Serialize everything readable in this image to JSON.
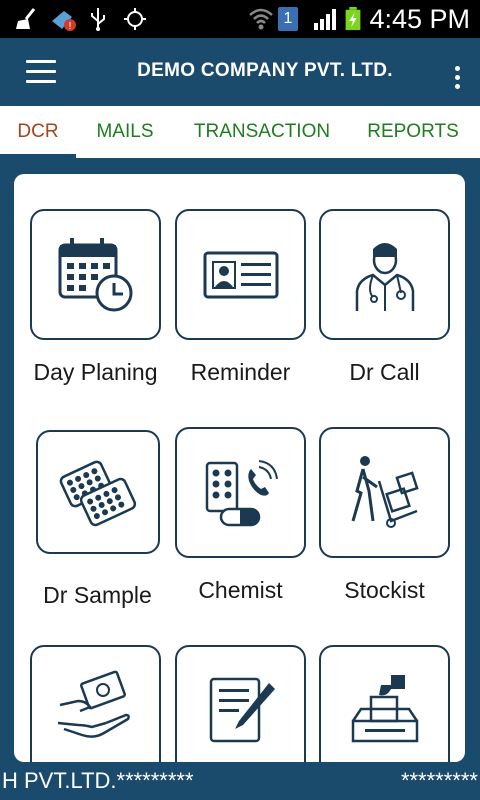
{
  "status_bar": {
    "time": "4:45 PM",
    "sim_label": "1",
    "icons": [
      "broom-icon",
      "notification-alert-icon",
      "usb-icon",
      "gps-icon",
      "wifi-icon",
      "sim-icon",
      "signal-icon",
      "battery-charging-icon"
    ]
  },
  "app_bar": {
    "title": "DEMO COMPANY PVT. LTD.",
    "menu_icon": "hamburger-menu-icon",
    "overflow_icon": "more-vert-icon"
  },
  "tabs": [
    {
      "label": "DCR",
      "active": true
    },
    {
      "label": "MAILS",
      "active": false
    },
    {
      "label": "TRANSACTION",
      "active": false
    },
    {
      "label": "REPORTS",
      "active": false
    }
  ],
  "tiles": [
    {
      "label": "Day Planing",
      "icon": "calendar-clock-icon"
    },
    {
      "label": "Reminder",
      "icon": "id-card-icon"
    },
    {
      "label": "Dr Call",
      "icon": "doctor-icon"
    },
    {
      "label": "Dr Sample",
      "icon": "pill-strips-icon"
    },
    {
      "label": "Chemist",
      "icon": "pharmacy-phone-icon"
    },
    {
      "label": "Stockist",
      "icon": "hand-truck-icon"
    },
    {
      "label": "",
      "icon": "cash-hand-icon"
    },
    {
      "label": "",
      "icon": "document-pen-icon"
    },
    {
      "label": "",
      "icon": "ballot-box-icon"
    }
  ],
  "ticker": {
    "left_text": "H PVT.LTD.*********",
    "right_text": "*********"
  },
  "colors": {
    "primary": "#1b4b6c",
    "tab_text": "#1e7d1e",
    "active_tab_text": "#a5431c",
    "icon_stroke": "#1b3a52"
  }
}
